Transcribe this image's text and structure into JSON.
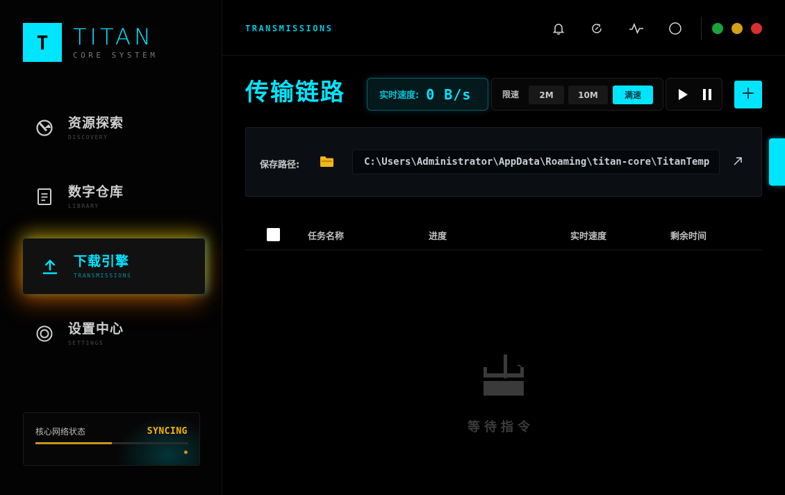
{
  "brand": {
    "logo_letter": "T",
    "name": "TITAN",
    "subtitle": "CORE SYSTEM",
    "accent": "#00e5ff"
  },
  "sidebar": {
    "items": [
      {
        "label": "资源探索",
        "sub": "DISCOVERY",
        "icon": "compass-icon",
        "active": false
      },
      {
        "label": "数字仓库",
        "sub": "LIBRARY",
        "icon": "document-icon",
        "active": false
      },
      {
        "label": "下载引擎",
        "sub": "TRANSMISSIONS",
        "icon": "upload-icon",
        "active": true
      },
      {
        "label": "设置中心",
        "sub": "SETTINGS",
        "icon": "target-icon",
        "active": false
      }
    ],
    "network": {
      "label": "核心网络状态",
      "status": "SYNCING",
      "progress": 0.5,
      "status_color": "#ffb300"
    }
  },
  "header": {
    "section": "TRANSMISSIONS",
    "icons": [
      "bell-icon",
      "refresh-icon",
      "pulse-icon",
      "circle-icon"
    ],
    "window_controls": {
      "green": "#1aa33a",
      "yellow": "#d4a017",
      "red": "#d63031"
    }
  },
  "main": {
    "title": "传输链路",
    "speed": {
      "label": "实时速度:",
      "value": "0 B/s"
    },
    "limit": {
      "label": "限速",
      "options": [
        "2M",
        "10M",
        "满速"
      ],
      "selected": "满速"
    },
    "path": {
      "label": "保存路径:",
      "value": "C:\\Users\\Administrator\\AppData\\Roaming\\titan-core\\TitanTemp"
    },
    "table": {
      "columns": [
        "任务名称",
        "进度",
        "实时速度",
        "剩余时间"
      ]
    },
    "empty_text": "等待指令"
  }
}
